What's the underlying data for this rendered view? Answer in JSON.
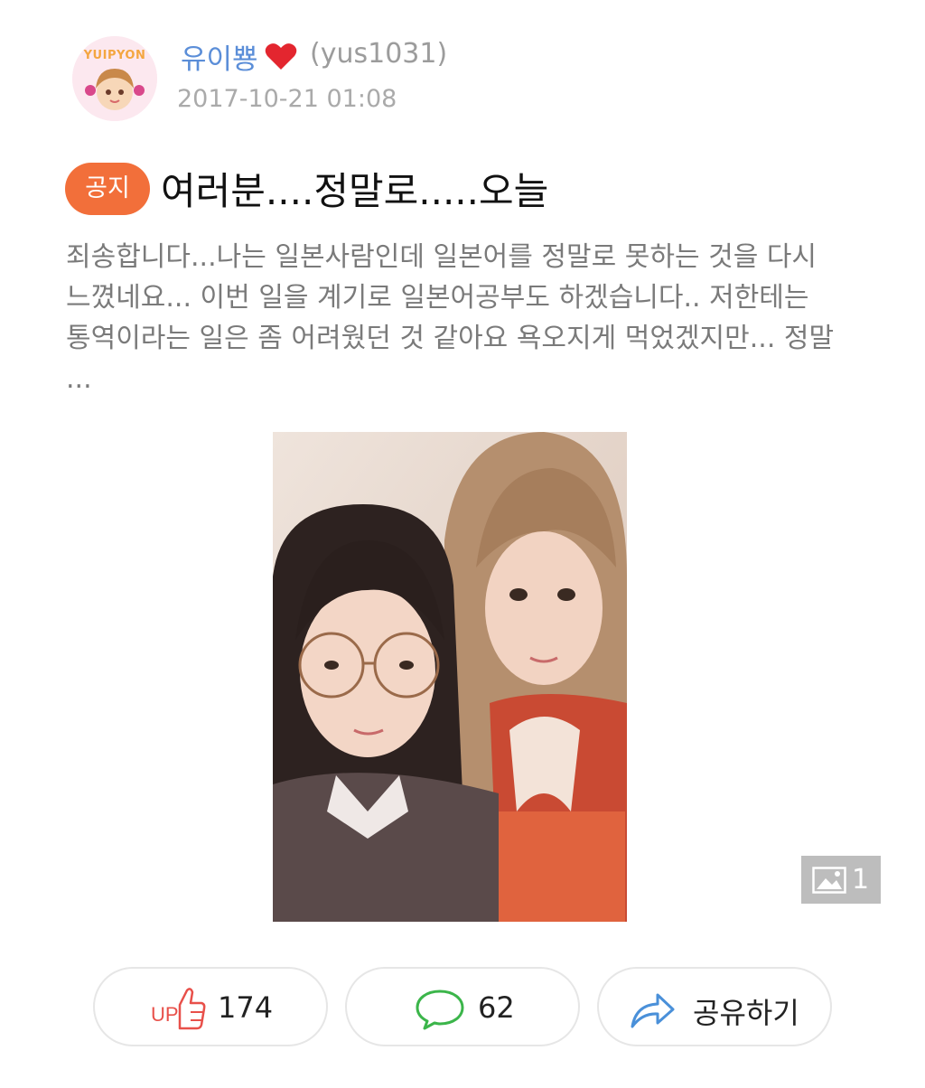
{
  "post": {
    "author": {
      "avatar_text": "YUIPYON",
      "display_name": "유이뿅",
      "emoji_icon": "red-heart-icon",
      "user_id": "(yus1031)"
    },
    "timestamp": "2017-10-21 01:08",
    "badge": "공지",
    "title": "여러분....정말로.....오늘",
    "body": "죄송합니다...나는 일본사람인데 일본어를 정말로 못하는 것을 다시 느꼈네요... 이번 일을 계기로 일본어공부도 하겠습니다.. 저한테는 통역이라는 일은 좀 어려웠던 것 같아요 욕오지게 먹었겠지만... 정말 ...",
    "image_count": "1"
  },
  "actions": {
    "up_count": "174",
    "up_icon_text": "UP",
    "comment_count": "62",
    "share_label": "공유하기"
  },
  "colors": {
    "badge": "#f26f3a",
    "username": "#5b8ed8",
    "up_icon": "#e8504a",
    "comment_icon": "#3bb54a",
    "share_icon": "#4a90d9"
  }
}
